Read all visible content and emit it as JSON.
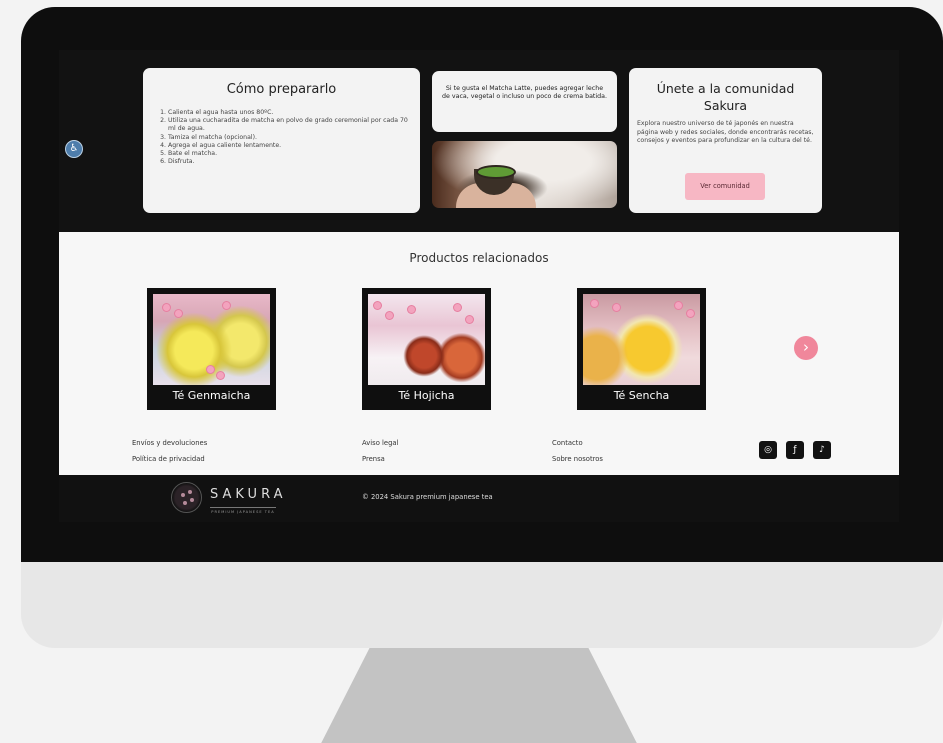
{
  "how_to": {
    "title": "Cómo prepararlo",
    "steps": [
      "Calienta el agua hasta unos 80ºC.",
      "Utiliza una cucharadita de matcha en polvo de grado ceremonial por cada 70 ml de agua.",
      "Tamiza el matcha (opcional).",
      "Agrega el agua caliente lentamente.",
      "Bate el matcha.",
      "Disfruta."
    ]
  },
  "tip": {
    "text": "Si te gusta el Matcha Latte, puedes agregar leche de vaca, vegetal o incluso un poco de crema batida."
  },
  "community": {
    "title": "Únete a la comunidad Sakura",
    "text": "Explora nuestro universo de té japonés en nuestra página web y redes sociales, donde encontrarás recetas, consejos y eventos para profundizar en la cultura del té.",
    "button": "Ver comunidad"
  },
  "related": {
    "title": "Productos relacionados",
    "products": [
      {
        "name": "Té Genmaicha"
      },
      {
        "name": "Té Hojicha"
      },
      {
        "name": "Té Sencha"
      }
    ]
  },
  "footer_links": {
    "col1": [
      "Envíos y devoluciones",
      "Política de privacidad"
    ],
    "col2": [
      "Aviso legal",
      "Prensa"
    ],
    "col3": [
      "Contacto",
      "Sobre nosotros"
    ]
  },
  "social": {
    "icons": [
      "instagram-icon",
      "facebook-icon",
      "tiktok-icon"
    ]
  },
  "brand": {
    "name": "SAKURA",
    "tagline": "PREMIUM JAPANESE TEA",
    "copyright": "© 2024 Sakura premium japanese tea"
  },
  "colors": {
    "accent_pink": "#f7b7c4",
    "next_arrow": "#f0879b",
    "dark_bg": "#121212"
  }
}
